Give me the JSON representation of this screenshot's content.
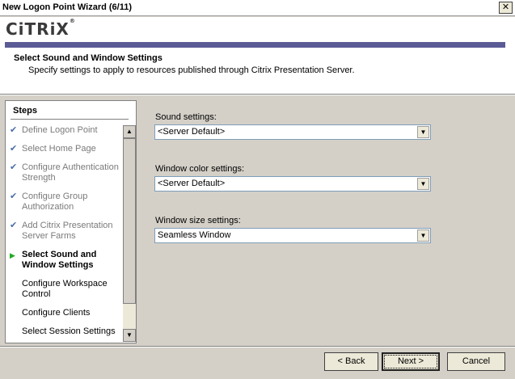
{
  "window": {
    "title": "New Logon Point Wizard (6/11)",
    "close_glyph": "✕"
  },
  "header": {
    "logo_text": "CiTRiX",
    "logo_mark": "®",
    "heading": "Select Sound and Window Settings",
    "subtitle": "Specify settings to apply to resources published through Citrix Presentation Server."
  },
  "steps": {
    "title": "Steps",
    "items": [
      {
        "label": "Define Logon Point",
        "state": "done",
        "mark": "✔"
      },
      {
        "label": "Select Home Page",
        "state": "done",
        "mark": "✔"
      },
      {
        "label": "Configure Authentication Strength",
        "state": "done",
        "mark": "✔"
      },
      {
        "label": "Configure Group Authorization",
        "state": "done",
        "mark": "✔"
      },
      {
        "label": "Add Citrix Presentation Server Farms",
        "state": "done",
        "mark": "✔"
      },
      {
        "label": "Select Sound and Window Settings",
        "state": "current",
        "mark": "▶"
      },
      {
        "label": "Configure Workspace Control",
        "state": "pending",
        "mark": ""
      },
      {
        "label": "Configure Clients",
        "state": "pending",
        "mark": ""
      },
      {
        "label": "Select Session Settings",
        "state": "pending",
        "mark": ""
      }
    ]
  },
  "form": {
    "sound": {
      "label": "Sound settings:",
      "value": "<Server Default>"
    },
    "color": {
      "label": "Window color settings:",
      "value": "<Server Default>"
    },
    "size": {
      "label": "Window size settings:",
      "value": "Seamless Window"
    }
  },
  "buttons": {
    "back": "< Back",
    "next": "Next >",
    "cancel": "Cancel"
  },
  "colors": {
    "brand_bar": "#5b5b95",
    "done_check": "#4a6fa5",
    "current_arrow": "#22aa22"
  },
  "icons": {
    "scroll_up": "▲",
    "scroll_down": "▼",
    "dropdown": "▼"
  }
}
